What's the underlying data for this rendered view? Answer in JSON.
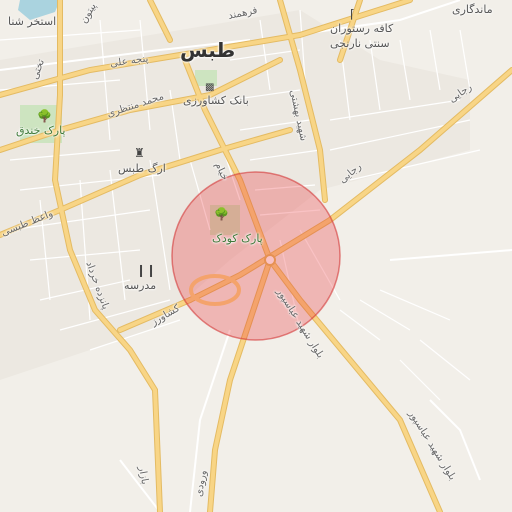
{
  "map": {
    "city_label": "طبس",
    "place_labels": {
      "park_kodak": "پارک کودک",
      "park_khandagh": "پارک خندق",
      "arg_tabas": "ارگ طبس",
      "madrese": "مدرسه",
      "bank_keshavarzi": "بانک کشاورزی",
      "cafe_line1": "کافه رستوران",
      "cafe_line2": "سنتی نارنجی",
      "pool": "استخر شنا",
      "hellenistic": "ماندگاری"
    },
    "road_labels": {
      "panje_ali": "پنجه علی",
      "mohammad_montazeri": "محمد منتظری",
      "farhmand": "فرهمند",
      "vaez_tabasi": "واعظ طبسی",
      "panzdah_khordad": "پانزده خرداد",
      "keshavarz": "کشاورز",
      "bolvar_abbaspour": "بلوار شهید عباسپور",
      "bolvar_abbaspour_south": "بلوار شهید عباسپور",
      "shahid_beheshti": "شهید بهشتی",
      "khayyam": "خیام",
      "rejaei_west": "رجایی",
      "rejaei_east": "رجایی",
      "takhti": "تختی",
      "payton": "پیتون",
      "vorodi": "ورودی",
      "bazaar": "بازار"
    },
    "icons": {
      "park": "tree-icon",
      "castle": "castle-icon",
      "school": "school-icon",
      "bank": "bank-icon",
      "cafe": "cafe-icon"
    },
    "colors": {
      "background": "#f2efe9",
      "major_road": "#f8d586",
      "major_road_casing": "#e4bb63",
      "minor_road": "#ffffff",
      "park": "#cde4c0",
      "water": "#aad3df",
      "circle_fill": "#e8232a",
      "circle_stroke": "#d43737"
    }
  }
}
